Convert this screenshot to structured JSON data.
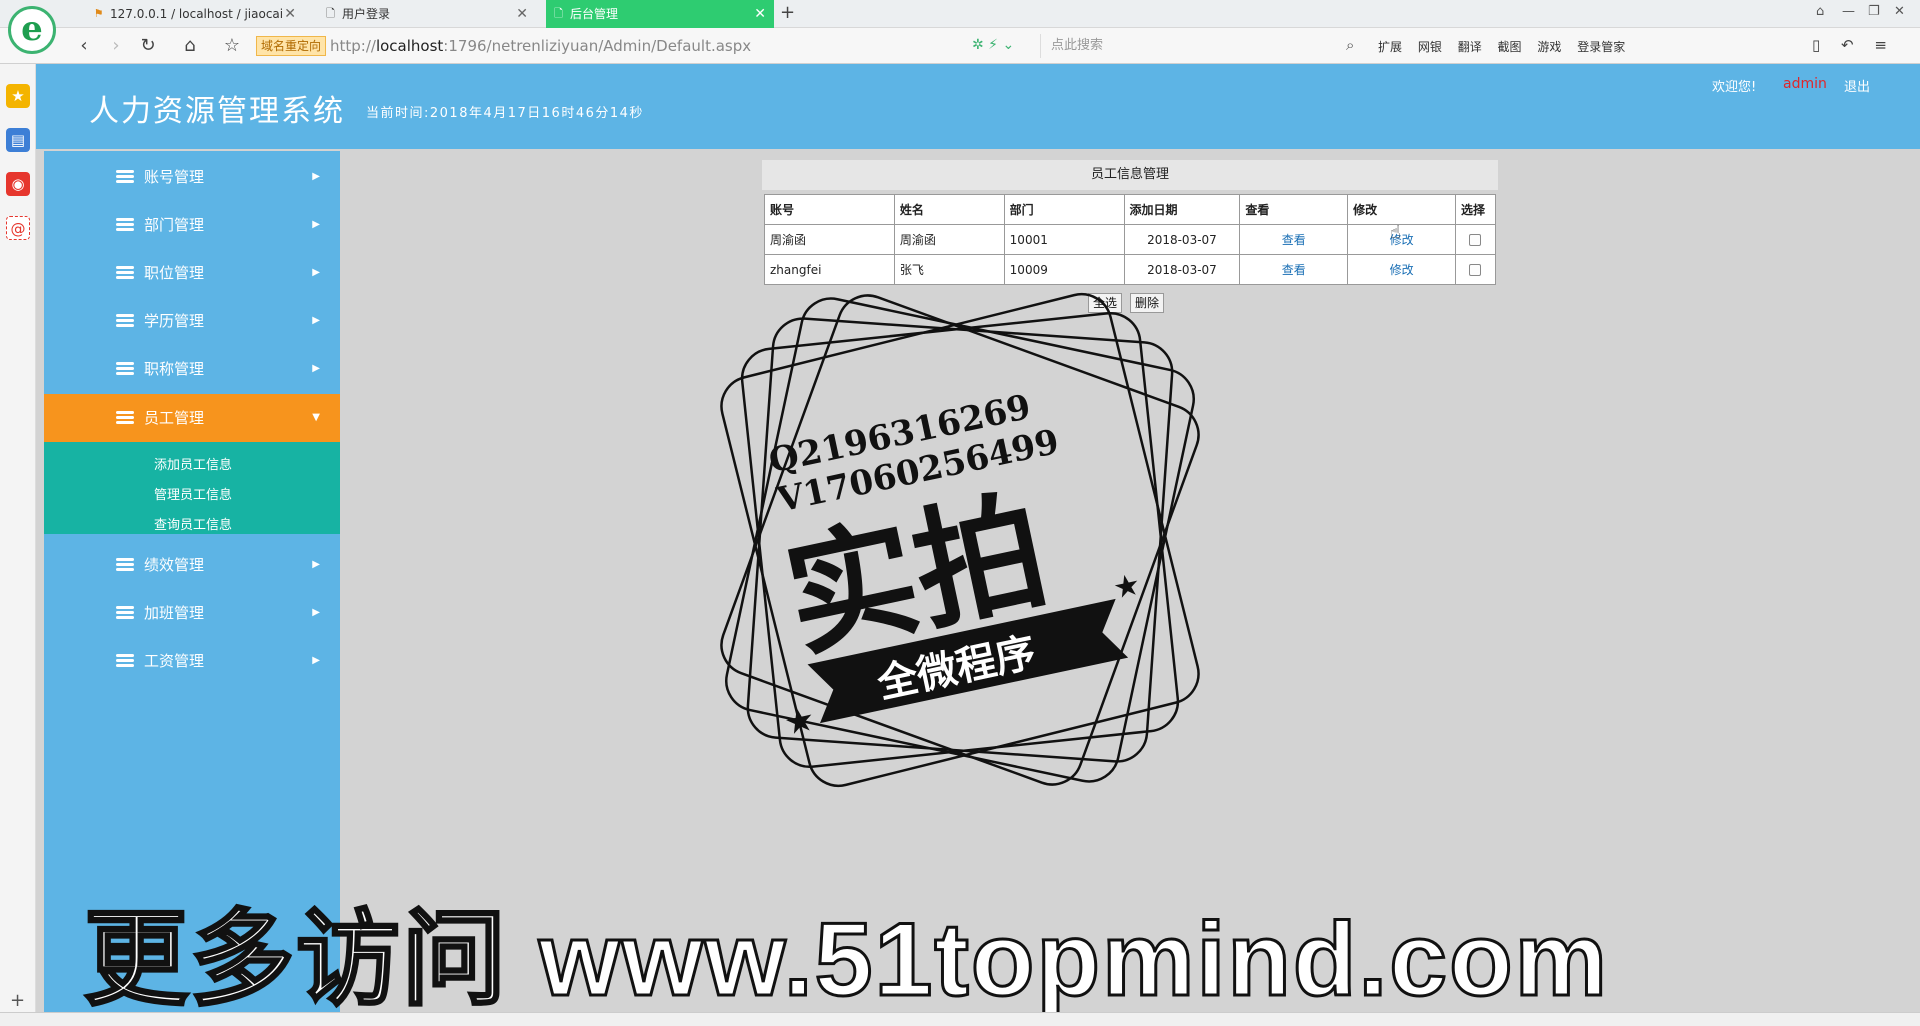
{
  "browser": {
    "tabs": [
      {
        "label": "127.0.0.1 / localhost / jiaocai",
        "icon": "pma-icon"
      },
      {
        "label": "用户登录",
        "icon": "page-icon"
      },
      {
        "label": "后台管理",
        "icon": "page-icon"
      }
    ],
    "new_tab": "+",
    "redirect_badge": "域名重定向",
    "url_prefix": "http://",
    "url_host": "localhost",
    "url_rest": ":1796/netrenliziyuan/Admin/Default.aspx",
    "search_placeholder": "点此搜索",
    "toolbar": [
      "扩展",
      "网银",
      "翻译",
      "截图",
      "游戏",
      "登录管家"
    ]
  },
  "header": {
    "title": "人力资源管理系统",
    "time_label": "当前时间:2018年4月17日16时46分14秒",
    "welcome": "欢迎您!",
    "user": "admin",
    "logout": "退出"
  },
  "sidebar": {
    "items": [
      {
        "label": "账号管理"
      },
      {
        "label": "部门管理"
      },
      {
        "label": "职位管理"
      },
      {
        "label": "学历管理"
      },
      {
        "label": "职称管理"
      },
      {
        "label": "员工管理",
        "active": true
      },
      {
        "label": "绩效管理"
      },
      {
        "label": "加班管理"
      },
      {
        "label": "工资管理"
      }
    ],
    "submenu": [
      "添加员工信息",
      "管理员工信息",
      "查询员工信息"
    ]
  },
  "main": {
    "panel_title": "员工信息管理",
    "columns": [
      "账号",
      "姓名",
      "部门",
      "添加日期",
      "查看",
      "修改",
      "选择"
    ],
    "rows": [
      {
        "account": "周渝函",
        "name": "周渝函",
        "dept": "10001",
        "date": "2018-03-07",
        "view": "查看",
        "edit": "修改",
        "selected": false
      },
      {
        "account": "zhangfei",
        "name": "张飞",
        "dept": "10009",
        "date": "2018-03-07",
        "view": "查看",
        "edit": "修改",
        "selected": false
      }
    ],
    "select_all_button": "全选",
    "delete_button": "删除"
  },
  "watermark": {
    "line1": "Q2196316269",
    "line2": "V17060256499",
    "big": "实拍",
    "ribbon": "全微程序",
    "bottom": "更多访问 www.51topmind.com"
  },
  "colors": {
    "header_bg": "#5db4e5",
    "active_menu": "#f7941d",
    "submenu_bg": "#17b3a3",
    "active_tab": "#2ecc71",
    "admin_red": "#e0262a"
  }
}
